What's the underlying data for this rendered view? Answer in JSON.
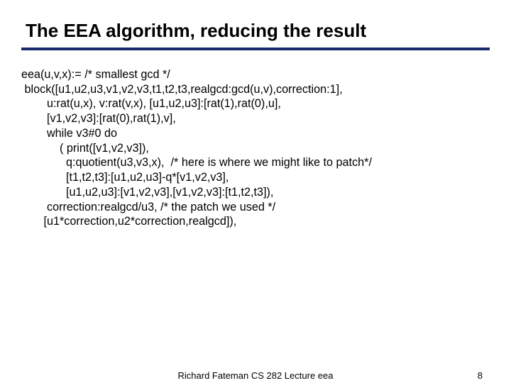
{
  "title": "The EEA algorithm, reducing the result",
  "code": {
    "l1": "eea(u,v,x):= /* smallest gcd */",
    "l2": " block([u1,u2,u3,v1,v2,v3,t1,t2,t3,realgcd:gcd(u,v),correction:1],",
    "l3": "        u:rat(u,x), v:rat(v,x), [u1,u2,u3]:[rat(1),rat(0),u],",
    "l4": "        [v1,v2,v3]:[rat(0),rat(1),v],",
    "l5": "        while v3#0 do",
    "l6": "            ( print([v1,v2,v3]),",
    "l7": "              q:quotient(u3,v3,x),  /* here is where we might like to patch*/",
    "l8": "              [t1,t2,t3]:[u1,u2,u3]-q*[v1,v2,v3],",
    "l9": "              [u1,u2,u3]:[v1,v2,v3],[v1,v2,v3]:[t1,t2,t3]),",
    "l10": "        correction:realgcd/u3, /* the patch we used */",
    "l11": "       [u1*correction,u2*correction,realgcd]),"
  },
  "footer": {
    "center": "Richard Fateman CS 282   Lecture eea",
    "page": "8"
  }
}
